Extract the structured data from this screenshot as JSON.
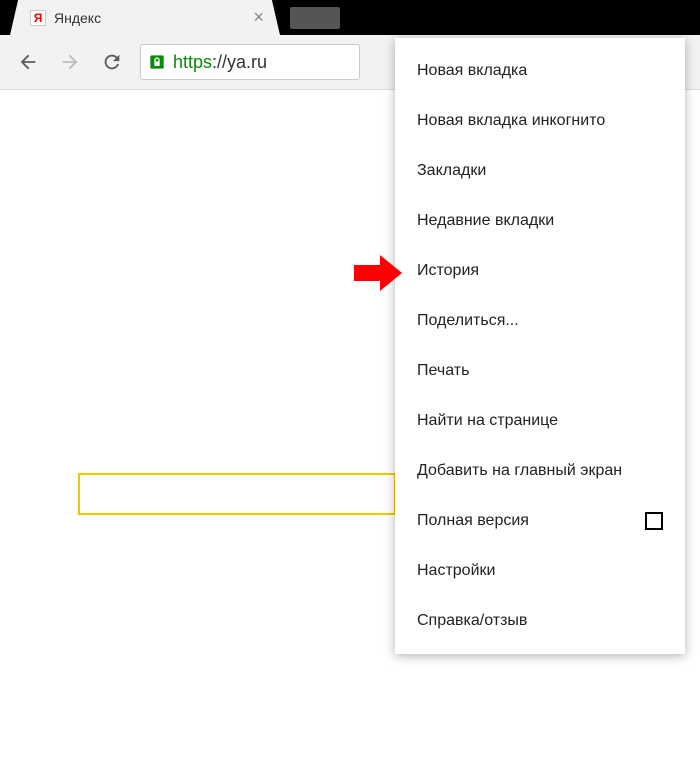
{
  "tab": {
    "favicon_letter": "Я",
    "title": "Яндекс"
  },
  "url": {
    "scheme": "https",
    "rest": "://ya.ru"
  },
  "menu": {
    "items": [
      "Новая вкладка",
      "Новая вкладка инкогнито",
      "Закладки",
      "Недавние вкладки",
      "История",
      "Поделиться...",
      "Печать",
      "Найти на странице",
      "Добавить на главный экран",
      "Полная версия",
      "Настройки",
      "Справка/отзыв"
    ],
    "checkbox_index": 9,
    "highlighted_index": 4
  },
  "colors": {
    "arrow": "#ff0000",
    "url_secure": "#0a8a0a",
    "searchbox_border": "#f0c800"
  }
}
